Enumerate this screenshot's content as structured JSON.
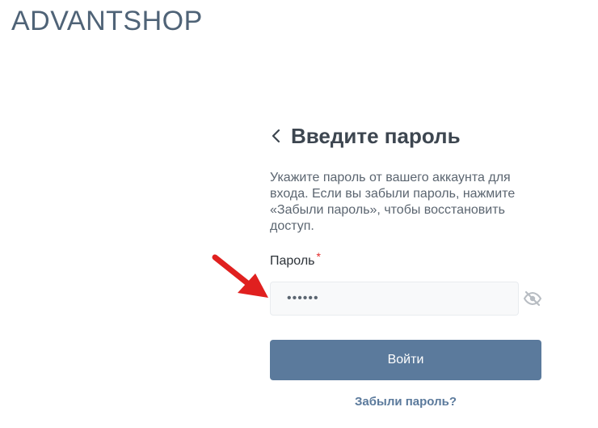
{
  "header": {
    "logo_text": "ADVANTSHOP"
  },
  "login": {
    "title": "Введите пароль",
    "back_icon": "chevron-left-icon",
    "description": "Укажите пароль от вашего аккаунта для входа. Если вы забыли пароль, нажмите «Забыли пароль», чтобы восстановить доступ.",
    "password_label": "Пароль",
    "required_marker": "*",
    "password_value": "••••••",
    "visibility_icon": "eye-off-icon",
    "submit_label": "Войти",
    "forgot_link": "Забыли пароль?"
  },
  "colors": {
    "accent": "#5b7a9c",
    "logo": "#4f6377",
    "required": "#e32b2b",
    "annotation_arrow": "#e0201f"
  }
}
